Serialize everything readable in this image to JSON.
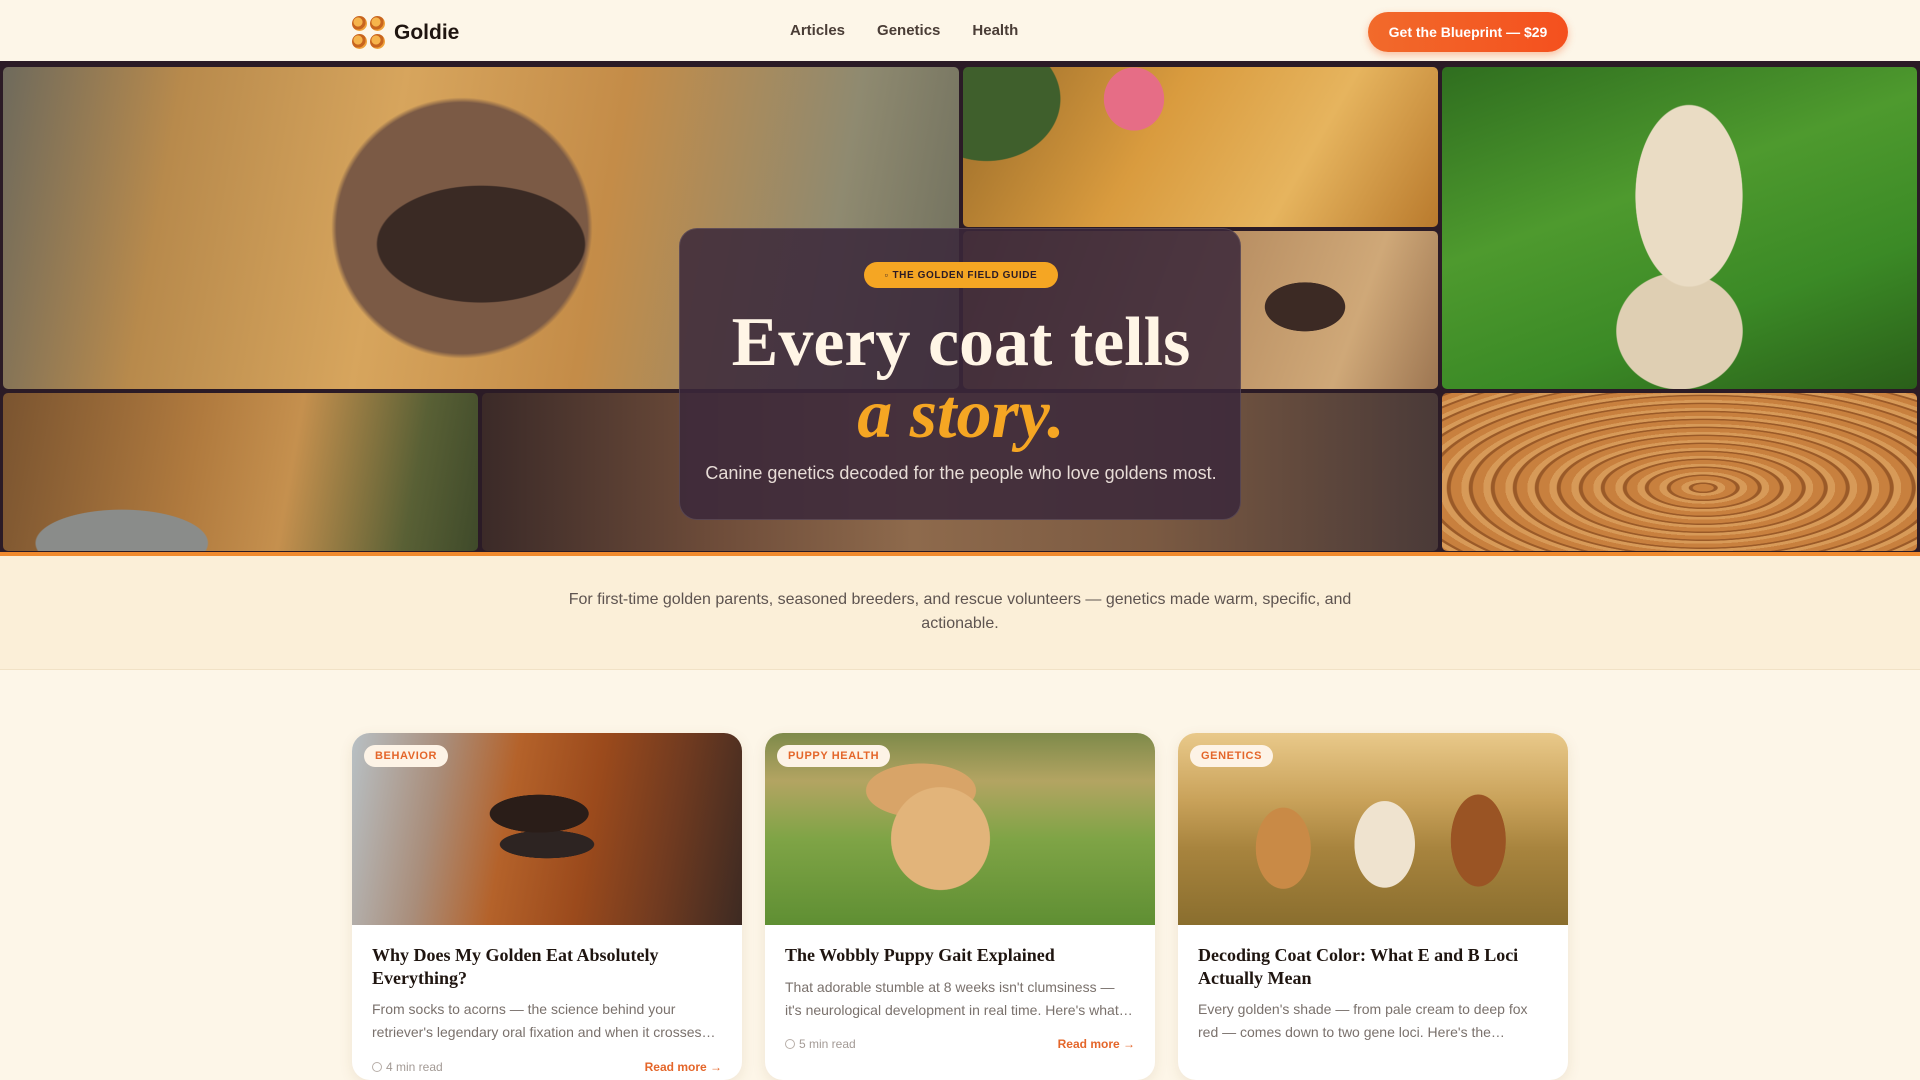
{
  "header": {
    "brand": "Goldie",
    "nav": [
      "Articles",
      "Genetics",
      "Health"
    ],
    "cta": "Get the Blueprint — $29"
  },
  "hero": {
    "pill": "THE GOLDEN FIELD GUIDE",
    "title_line1": "Every coat tells",
    "title_line2": "a story.",
    "subtitle": "Canine genetics decoded for the people who love goldens most.",
    "photos": [
      "golden-nose-closeup",
      "golden-tongue",
      "golden-running-in-grass",
      "golden-muzzle",
      "golden-puppy-sleeping",
      "golden-face-blurred",
      "litter-of-puppies"
    ]
  },
  "intro": {
    "text": "For first-time golden parents, seasoned breeders, and rescue volunteers — genetics made warm, specific, and actionable."
  },
  "cards": [
    {
      "tag": "BEHAVIOR",
      "title": "Why Does My Golden Eat Absolutely Everything?",
      "desc": "From socks to acorns — the science behind your retriever's legendary oral fixation and when it crosses…",
      "read_time": "4 min read",
      "cta": "Read more →"
    },
    {
      "tag": "PUPPY HEALTH",
      "title": "The Wobbly Puppy Gait Explained",
      "desc": "That adorable stumble at 8 weeks isn't clumsiness — it's neurological development in real time. Here's what…",
      "read_time": "5 min read",
      "cta": "Read more →"
    },
    {
      "tag": "GENETICS",
      "title": "Decoding Coat Color: What E and B Loci Actually Mean",
      "desc": "Every golden's shade — from pale cream to deep fox red — comes down to two gene loci. Here's the…"
    }
  ],
  "colors": {
    "accent": "#f26a2b",
    "gold": "#f5a623",
    "cream": "#fdf6e8",
    "plum": "#2b1b26"
  }
}
